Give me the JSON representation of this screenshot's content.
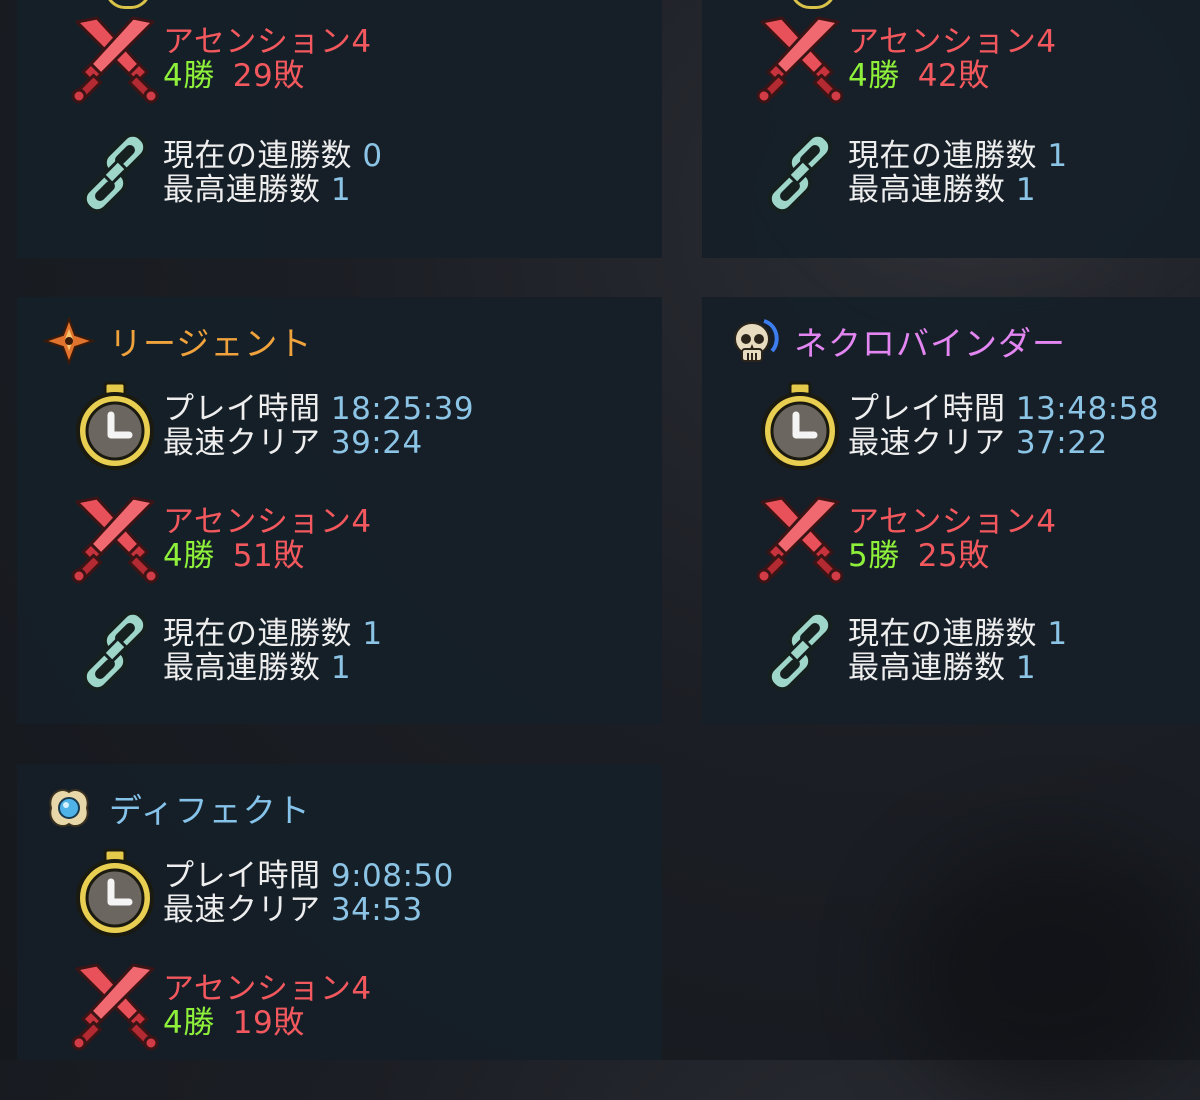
{
  "colors": {
    "value_blue": "#8cc4e6",
    "ascension_red": "#f2585d",
    "wins_green": "#8ef03a",
    "regent_orange": "#f0a23c",
    "necro_pink": "#e386f2",
    "defect_blue": "#86c3ea"
  },
  "labels": {
    "playtime": "プレイ時間",
    "fastest": "最速クリア",
    "current_streak": "現在の連勝数",
    "best_streak": "最高連勝数",
    "ascension": "アセンション"
  },
  "top_left": {
    "ascension": "4",
    "wins": "4",
    "wins_unit": "勝",
    "losses": "29",
    "losses_unit": "敗",
    "current_streak": "0",
    "best_streak": "1"
  },
  "top_right": {
    "ascension": "4",
    "wins": "4",
    "wins_unit": "勝",
    "losses": "42",
    "losses_unit": "敗",
    "current_streak": "1",
    "best_streak": "1"
  },
  "regent": {
    "name": "リージェント",
    "icon": "regent-crest-icon",
    "playtime": "18:25:39",
    "fastest": "39:24",
    "ascension": "4",
    "wins": "4",
    "wins_unit": "勝",
    "losses": "51",
    "losses_unit": "敗",
    "current_streak": "1",
    "best_streak": "1"
  },
  "necrobinder": {
    "name": "ネクロバインダー",
    "icon": "skull-icon",
    "playtime": "13:48:58",
    "fastest": "37:22",
    "ascension": "4",
    "wins": "5",
    "wins_unit": "勝",
    "losses": "25",
    "losses_unit": "敗",
    "current_streak": "1",
    "best_streak": "1"
  },
  "defect": {
    "name": "ディフェクト",
    "icon": "orb-icon",
    "playtime": "9:08:50",
    "fastest": "34:53",
    "ascension": "4",
    "wins": "4",
    "wins_unit": "勝",
    "losses": "19",
    "losses_unit": "敗"
  }
}
